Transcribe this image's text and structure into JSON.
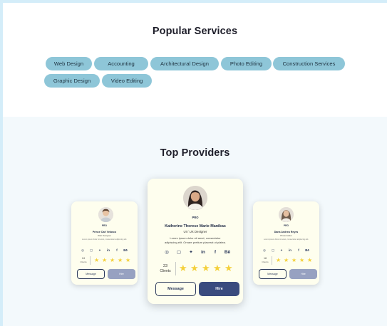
{
  "services": {
    "title": "Popular Services",
    "chips": [
      "Web Design",
      "Accounting",
      "Architectural Design",
      "Photo Editing",
      "Construction Services",
      "Graphic Design",
      "Video Editing"
    ]
  },
  "providers": {
    "title": "Top Providers",
    "cards": [
      {
        "badge": "PRO",
        "name": "Prince Carl Velasco",
        "role": "Web Designer",
        "bio": "Lorem ipsum dolor sit amet, consectetur adipiscing elit.",
        "clients_count": "24",
        "clients_label": "Clients",
        "message_label": "Message",
        "hire_label": "Hire"
      },
      {
        "badge": "PRO",
        "name": "Katherine Therese Marie Manibas",
        "role": "UI / UX Designer",
        "bio_line1": "Lorem ipsum dolor sit amet, consectetur",
        "bio_line2": "adipiscing elit. Ornare pretium placerat ut platea.",
        "clients_count": "23",
        "clients_label": "Clients",
        "message_label": "Message",
        "hire_label": "Hire"
      },
      {
        "badge": "PRO",
        "name": "Dana Andrea Reyes",
        "role": "Photo Editor",
        "bio": "Lorem ipsum dolor sit amet, consectetur adipiscing elit.",
        "clients_count": "18",
        "clients_label": "Clients",
        "message_label": "Message",
        "hire_label": "Hire"
      }
    ],
    "social_icons": [
      "dribbble-icon",
      "instagram-icon",
      "twitter-icon",
      "linkedin-icon",
      "facebook-icon",
      "behance-icon"
    ],
    "social_glyphs": [
      "◎",
      "▢",
      "✦",
      "in",
      "f",
      "Bē"
    ],
    "star_glyph": "★",
    "rating_stars": 5
  }
}
